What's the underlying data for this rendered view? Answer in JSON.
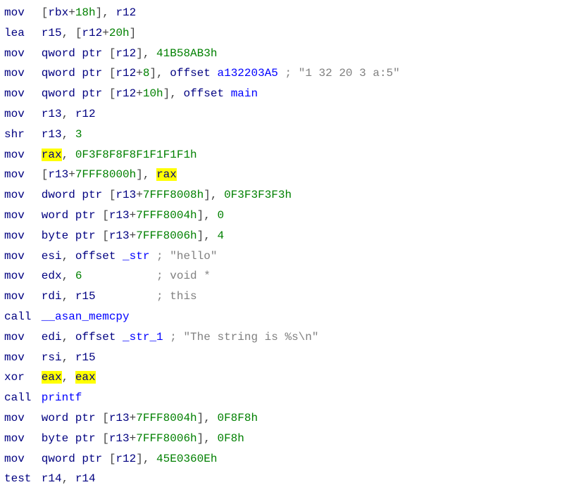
{
  "code": {
    "lines": [
      {
        "mn": "mov",
        "ops": [
          {
            "t": "punct",
            "v": "["
          },
          {
            "t": "reg",
            "v": "rbx"
          },
          {
            "t": "punct",
            "v": "+"
          },
          {
            "t": "num",
            "v": "18h"
          },
          {
            "t": "punct",
            "v": "], "
          },
          {
            "t": "reg",
            "v": "r12"
          }
        ]
      },
      {
        "mn": "lea",
        "ops": [
          {
            "t": "reg",
            "v": "r15"
          },
          {
            "t": "punct",
            "v": ", ["
          },
          {
            "t": "reg",
            "v": "r12"
          },
          {
            "t": "punct",
            "v": "+"
          },
          {
            "t": "num",
            "v": "20h"
          },
          {
            "t": "punct",
            "v": "]"
          }
        ]
      },
      {
        "mn": "mov",
        "ops": [
          {
            "t": "kw",
            "v": "qword ptr"
          },
          {
            "t": "punct",
            "v": " ["
          },
          {
            "t": "reg",
            "v": "r12"
          },
          {
            "t": "punct",
            "v": "], "
          },
          {
            "t": "num",
            "v": "41B58AB3h"
          }
        ]
      },
      {
        "mn": "mov",
        "ops": [
          {
            "t": "kw",
            "v": "qword ptr"
          },
          {
            "t": "punct",
            "v": " ["
          },
          {
            "t": "reg",
            "v": "r12"
          },
          {
            "t": "punct",
            "v": "+"
          },
          {
            "t": "num",
            "v": "8"
          },
          {
            "t": "punct",
            "v": "], "
          },
          {
            "t": "kw",
            "v": "offset"
          },
          {
            "t": "txt",
            "v": " "
          },
          {
            "t": "sym",
            "v": "a132203A5"
          },
          {
            "t": "txt",
            "v": " "
          },
          {
            "t": "cmt",
            "v": "; \"1 32 20 3 a:5\""
          }
        ]
      },
      {
        "mn": "mov",
        "ops": [
          {
            "t": "kw",
            "v": "qword ptr"
          },
          {
            "t": "punct",
            "v": " ["
          },
          {
            "t": "reg",
            "v": "r12"
          },
          {
            "t": "punct",
            "v": "+"
          },
          {
            "t": "num",
            "v": "10h"
          },
          {
            "t": "punct",
            "v": "], "
          },
          {
            "t": "kw",
            "v": "offset"
          },
          {
            "t": "txt",
            "v": " "
          },
          {
            "t": "sym",
            "v": "main"
          }
        ]
      },
      {
        "mn": "mov",
        "ops": [
          {
            "t": "reg",
            "v": "r13"
          },
          {
            "t": "punct",
            "v": ", "
          },
          {
            "t": "reg",
            "v": "r12"
          }
        ]
      },
      {
        "mn": "shr",
        "ops": [
          {
            "t": "reg",
            "v": "r13"
          },
          {
            "t": "punct",
            "v": ", "
          },
          {
            "t": "num",
            "v": "3"
          }
        ]
      },
      {
        "mn": "mov",
        "ops": [
          {
            "t": "hl",
            "v": "rax"
          },
          {
            "t": "punct",
            "v": ", "
          },
          {
            "t": "num",
            "v": "0F3F8F8F8F1F1F1F1h"
          }
        ]
      },
      {
        "mn": "mov",
        "ops": [
          {
            "t": "punct",
            "v": "["
          },
          {
            "t": "reg",
            "v": "r13"
          },
          {
            "t": "punct",
            "v": "+"
          },
          {
            "t": "num",
            "v": "7FFF8000h"
          },
          {
            "t": "punct",
            "v": "], "
          },
          {
            "t": "hl",
            "v": "rax"
          }
        ]
      },
      {
        "mn": "mov",
        "ops": [
          {
            "t": "kw",
            "v": "dword ptr"
          },
          {
            "t": "punct",
            "v": " ["
          },
          {
            "t": "reg",
            "v": "r13"
          },
          {
            "t": "punct",
            "v": "+"
          },
          {
            "t": "num",
            "v": "7FFF8008h"
          },
          {
            "t": "punct",
            "v": "], "
          },
          {
            "t": "num",
            "v": "0F3F3F3F3h"
          }
        ]
      },
      {
        "mn": "mov",
        "ops": [
          {
            "t": "kw",
            "v": "word ptr"
          },
          {
            "t": "punct",
            "v": " ["
          },
          {
            "t": "reg",
            "v": "r13"
          },
          {
            "t": "punct",
            "v": "+"
          },
          {
            "t": "num",
            "v": "7FFF8004h"
          },
          {
            "t": "punct",
            "v": "], "
          },
          {
            "t": "num",
            "v": "0"
          }
        ]
      },
      {
        "mn": "mov",
        "ops": [
          {
            "t": "kw",
            "v": "byte ptr"
          },
          {
            "t": "punct",
            "v": " ["
          },
          {
            "t": "reg",
            "v": "r13"
          },
          {
            "t": "punct",
            "v": "+"
          },
          {
            "t": "num",
            "v": "7FFF8006h"
          },
          {
            "t": "punct",
            "v": "], "
          },
          {
            "t": "num",
            "v": "4"
          }
        ]
      },
      {
        "mn": "mov",
        "ops": [
          {
            "t": "reg",
            "v": "esi"
          },
          {
            "t": "punct",
            "v": ", "
          },
          {
            "t": "kw",
            "v": "offset"
          },
          {
            "t": "txt",
            "v": " "
          },
          {
            "t": "sym",
            "v": "_str"
          },
          {
            "t": "txt",
            "v": " "
          },
          {
            "t": "cmt",
            "v": "; \"hello\""
          }
        ]
      },
      {
        "mn": "mov",
        "ops": [
          {
            "t": "reg",
            "v": "edx"
          },
          {
            "t": "punct",
            "v": ", "
          },
          {
            "t": "num",
            "v": "6"
          },
          {
            "t": "txt",
            "v": "           "
          },
          {
            "t": "cmt",
            "v": "; void *"
          }
        ]
      },
      {
        "mn": "mov",
        "ops": [
          {
            "t": "reg",
            "v": "rdi"
          },
          {
            "t": "punct",
            "v": ", "
          },
          {
            "t": "reg",
            "v": "r15"
          },
          {
            "t": "txt",
            "v": "         "
          },
          {
            "t": "cmt",
            "v": "; this"
          }
        ]
      },
      {
        "mn": "call",
        "ops": [
          {
            "t": "sym",
            "v": "__asan_memcpy"
          }
        ]
      },
      {
        "mn": "mov",
        "ops": [
          {
            "t": "reg",
            "v": "edi"
          },
          {
            "t": "punct",
            "v": ", "
          },
          {
            "t": "kw",
            "v": "offset"
          },
          {
            "t": "txt",
            "v": " "
          },
          {
            "t": "sym",
            "v": "_str_1"
          },
          {
            "t": "txt",
            "v": " "
          },
          {
            "t": "cmt",
            "v": "; \"The string is %s\\n\""
          }
        ]
      },
      {
        "mn": "mov",
        "ops": [
          {
            "t": "reg",
            "v": "rsi"
          },
          {
            "t": "punct",
            "v": ", "
          },
          {
            "t": "reg",
            "v": "r15"
          }
        ]
      },
      {
        "mn": "xor",
        "ops": [
          {
            "t": "hl",
            "v": "eax"
          },
          {
            "t": "punct",
            "v": ", "
          },
          {
            "t": "hl",
            "v": "eax"
          }
        ]
      },
      {
        "mn": "call",
        "ops": [
          {
            "t": "sym",
            "v": "printf"
          }
        ]
      },
      {
        "mn": "mov",
        "ops": [
          {
            "t": "kw",
            "v": "word ptr"
          },
          {
            "t": "punct",
            "v": " ["
          },
          {
            "t": "reg",
            "v": "r13"
          },
          {
            "t": "punct",
            "v": "+"
          },
          {
            "t": "num",
            "v": "7FFF8004h"
          },
          {
            "t": "punct",
            "v": "], "
          },
          {
            "t": "num",
            "v": "0F8F8h"
          }
        ]
      },
      {
        "mn": "mov",
        "ops": [
          {
            "t": "kw",
            "v": "byte ptr"
          },
          {
            "t": "punct",
            "v": " ["
          },
          {
            "t": "reg",
            "v": "r13"
          },
          {
            "t": "punct",
            "v": "+"
          },
          {
            "t": "num",
            "v": "7FFF8006h"
          },
          {
            "t": "punct",
            "v": "], "
          },
          {
            "t": "num",
            "v": "0F8h"
          }
        ]
      },
      {
        "mn": "mov",
        "ops": [
          {
            "t": "kw",
            "v": "qword ptr"
          },
          {
            "t": "punct",
            "v": " ["
          },
          {
            "t": "reg",
            "v": "r12"
          },
          {
            "t": "punct",
            "v": "], "
          },
          {
            "t": "num",
            "v": "45E0360Eh"
          }
        ]
      },
      {
        "mn": "test",
        "ops": [
          {
            "t": "reg",
            "v": "r14"
          },
          {
            "t": "punct",
            "v": ", "
          },
          {
            "t": "reg",
            "v": "r14"
          }
        ]
      }
    ]
  },
  "tokenClasses": {
    "reg": "reg",
    "num": "num",
    "kw": "kw",
    "sym": "sym",
    "cmt": "cmt",
    "punct": "punct",
    "txt": "txt",
    "hl": "hl"
  }
}
